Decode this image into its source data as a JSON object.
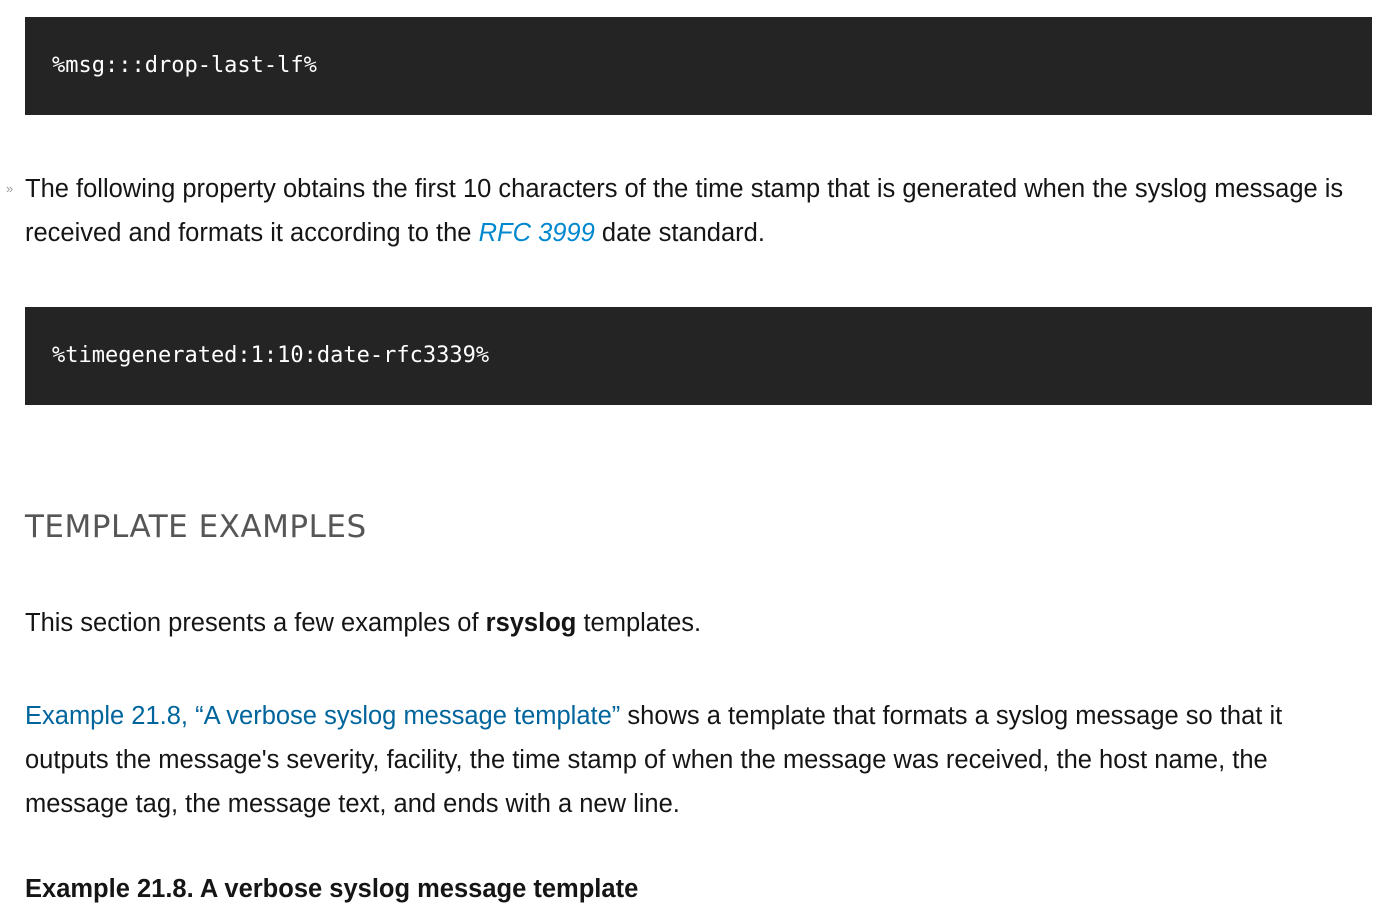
{
  "code_blocks": {
    "first": "%msg:::drop-last-lf%",
    "second": "%timegenerated:1:10:date-rfc3339%"
  },
  "paragraphs": {
    "timestamp": {
      "before_link": "The following property obtains the first 10 characters of the time stamp that is generated when the syslog message is received and formats it according to the ",
      "link_text": "RFC 3999",
      "after_link": " date standard."
    },
    "intro": {
      "before_bold": "This section presents a few examples of ",
      "bold": "rsyslog",
      "after_bold": " templates."
    },
    "verbose": {
      "link_text": "Example 21.8, “A verbose syslog message template”",
      "after_link": " shows a template that formats a syslog message so that it outputs the message's severity, facility, the time stamp of when the message was received, the host name, the message tag, the message text, and ends with a new line."
    }
  },
  "section": {
    "heading": "TEMPLATE EXAMPLES"
  },
  "example": {
    "title": "Example 21.8. A verbose syslog message template"
  },
  "colors": {
    "code_background": "#242424",
    "link_rfc": "#0088ce",
    "link_xref": "#00659c",
    "heading": "#565656"
  }
}
